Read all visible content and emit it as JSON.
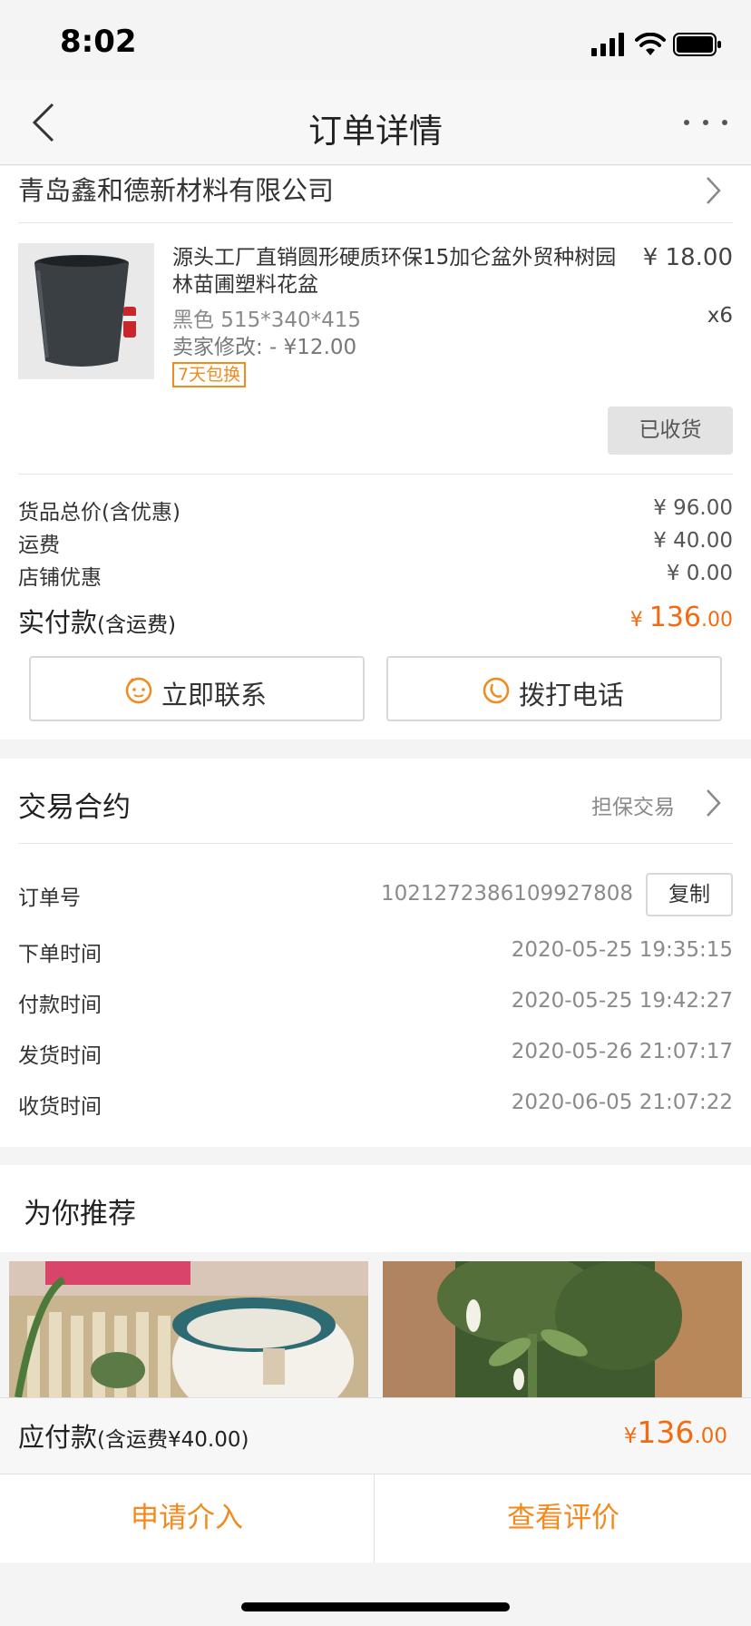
{
  "status_bar": {
    "time": "8:02"
  },
  "nav": {
    "title": "订单详情"
  },
  "shop": {
    "name": "青岛鑫和德新材料有限公司"
  },
  "product": {
    "title": "源头工厂直销圆形硬质环保15加仑盆外贸种树园林苗圃塑料花盆",
    "price": "¥ 18.00",
    "spec": "黑色 515*340*415",
    "quantity": "x6",
    "seller_modified": "卖家修改: - ¥12.00",
    "tag": "7天包换",
    "status_button": "已收货"
  },
  "summary": {
    "rows": [
      {
        "label": "货品总价(含优惠)",
        "value": "¥ 96.00"
      },
      {
        "label": "运费",
        "value": "¥ 40.00"
      },
      {
        "label": "店铺优惠",
        "value": "¥ 0.00"
      }
    ],
    "paid_label": "实付款",
    "paid_sub": "(含运费)",
    "paid_currency": "¥ ",
    "paid_int": "136",
    "paid_dec": ".00"
  },
  "actions": {
    "contact": "立即联系",
    "call": "拨打电话"
  },
  "contract": {
    "title": "交易合约",
    "type": "担保交易",
    "order_no_label": "订单号",
    "order_no": "1021272386109927808",
    "copy": "复制",
    "times": [
      {
        "label": "下单时间",
        "value": "2020-05-25 19:35:15"
      },
      {
        "label": "付款时间",
        "value": "2020-05-25 19:42:27"
      },
      {
        "label": "发货时间",
        "value": "2020-05-26 21:07:17"
      },
      {
        "label": "收货时间",
        "value": "2020-06-05 21:07:22"
      }
    ]
  },
  "recommend": {
    "title": "为你推荐"
  },
  "footer": {
    "due_label": "应付款",
    "due_sub": "(含运费¥40.00)",
    "due_currency": "¥",
    "due_int": "136",
    "due_dec": ".00",
    "apply_button": "申请介入",
    "review_button": "查看评价"
  },
  "colors": {
    "accent": "#f26b12",
    "brand_orange": "#f28a1e"
  }
}
